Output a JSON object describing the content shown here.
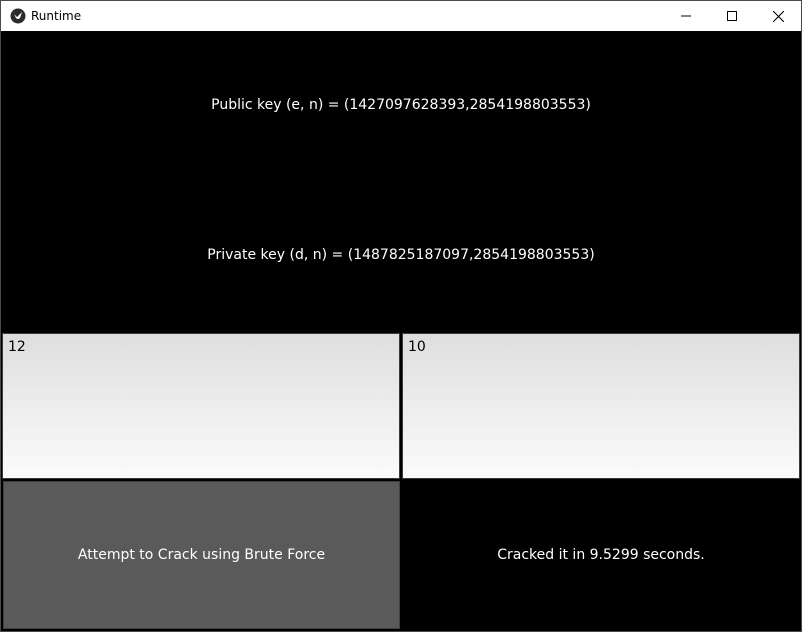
{
  "window": {
    "title": "Runtime",
    "app_icon": "kivy-icon",
    "controls": {
      "minimize_icon": "minimize-icon",
      "maximize_icon": "maximize-icon",
      "close_icon": "close-icon"
    }
  },
  "keys": {
    "public": "Public key (e, n) = (1427097628393,2854198803553)",
    "private": "Private key (d, n) = (1487825187097,2854198803553)"
  },
  "inputs": {
    "left_value": "12",
    "right_value": "10"
  },
  "actions": {
    "crack_label": "Attempt to Crack using Brute Force"
  },
  "result": {
    "text": "Cracked it in 9.5299 seconds."
  },
  "colors": {
    "background": "#000000",
    "button": "#5a5a5a",
    "text": "#ffffff"
  }
}
